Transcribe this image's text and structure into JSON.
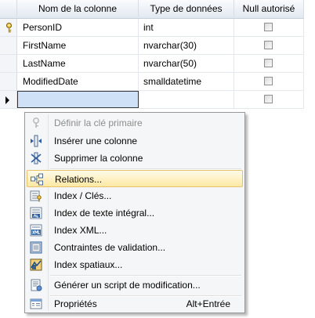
{
  "grid": {
    "headers": [
      "Nom de la colonne",
      "Type de données",
      "Null autorisé"
    ],
    "rows": [
      {
        "name": "PersonID",
        "type": "int",
        "nullable": false,
        "primary_key": true
      },
      {
        "name": "FirstName",
        "type": "nvarchar(30)",
        "nullable": false,
        "primary_key": false
      },
      {
        "name": "LastName",
        "type": "nvarchar(50)",
        "nullable": false,
        "primary_key": false
      },
      {
        "name": "ModifiedDate",
        "type": "smalldatetime",
        "nullable": false,
        "primary_key": false
      },
      {
        "name": "",
        "type": "",
        "nullable": false,
        "primary_key": false,
        "current": true
      }
    ]
  },
  "context_menu": {
    "items": [
      {
        "label": "Définir la clé primaire",
        "icon": "primary-key-icon",
        "enabled": false
      },
      {
        "label": "Insérer une colonne",
        "icon": "insert-column-icon",
        "enabled": true
      },
      {
        "label": "Supprimer la colonne",
        "icon": "delete-column-icon",
        "enabled": true
      },
      {
        "label": "Relations...",
        "icon": "relationships-icon",
        "enabled": true,
        "highlighted": true
      },
      {
        "label": "Index / Clés...",
        "icon": "indexes-keys-icon",
        "enabled": true
      },
      {
        "label": "Index de texte intégral...",
        "icon": "fulltext-index-icon",
        "enabled": true
      },
      {
        "label": "Index XML...",
        "icon": "xml-index-icon",
        "enabled": true
      },
      {
        "label": "Contraintes de validation...",
        "icon": "check-constraints-icon",
        "enabled": true
      },
      {
        "label": "Index spatiaux...",
        "icon": "spatial-index-icon",
        "enabled": true
      },
      {
        "label": "Générer un script de modification...",
        "icon": "generate-script-icon",
        "enabled": true
      },
      {
        "label": "Propriétés",
        "icon": "properties-icon",
        "enabled": true,
        "shortcut": "Alt+Entrée"
      }
    ]
  },
  "colors": {
    "highlight": "#fde8a3",
    "selected_cell": "#cfe1f6",
    "header": "#e3e9f1"
  }
}
